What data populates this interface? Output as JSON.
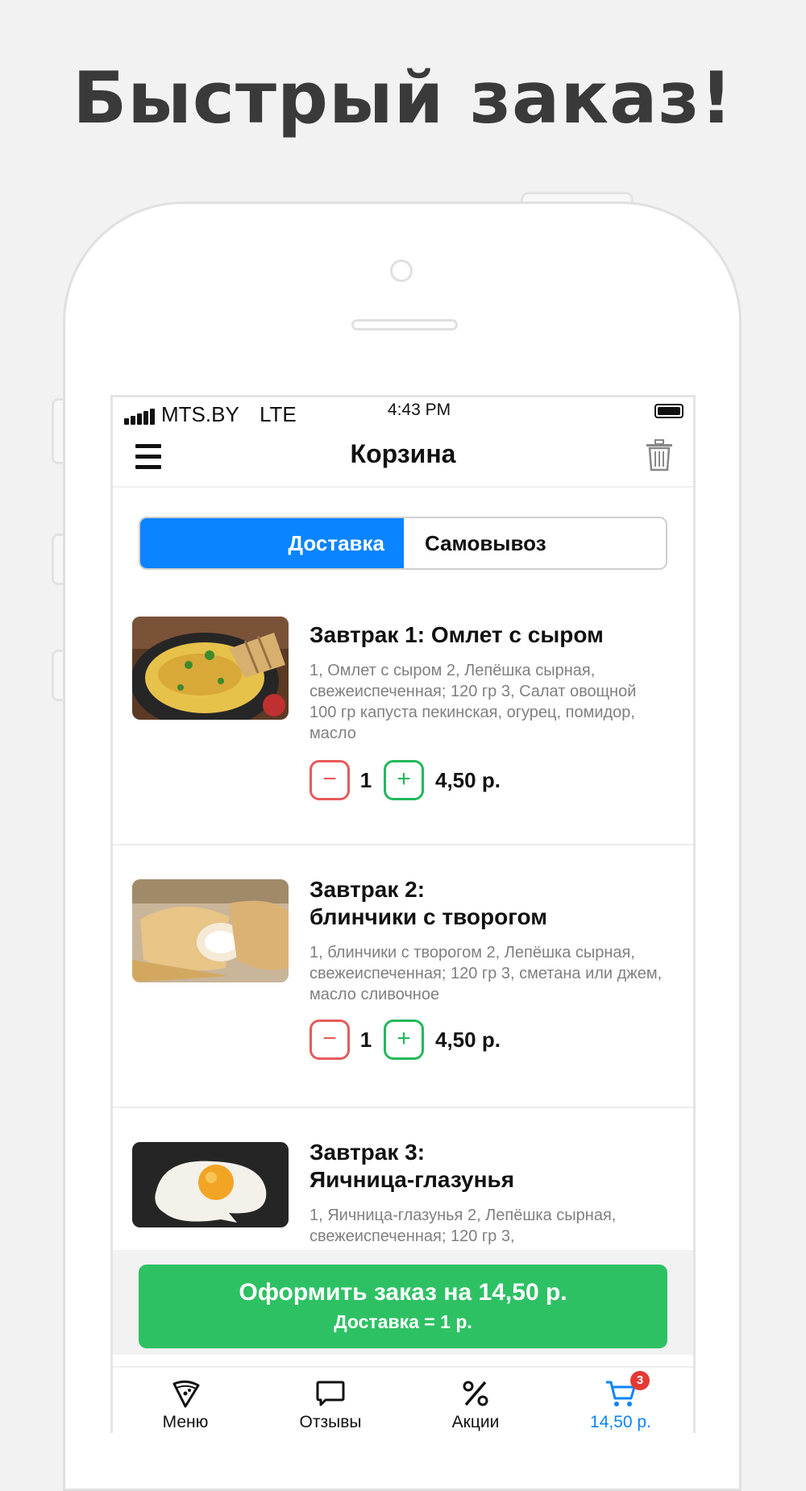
{
  "headline": "Быстрый заказ!",
  "status_bar": {
    "carrier": "MTS.BY",
    "network": "LTE",
    "time": "4:43 PM"
  },
  "navbar": {
    "title": "Корзина"
  },
  "delivery_toggle": {
    "active": "Доставка",
    "inactive": "Самовывоз"
  },
  "cart_items": [
    {
      "title": "Завтрак 1: Омлет с сыром",
      "description": "1, Омлет с сыром 2, Лепёшка сырная, свежеиспеченная; 120 гр 3, Салат овощной 100 гр капуста пекинская, огурец, помидор, масло",
      "minus": "−",
      "quantity": "1",
      "plus": "+",
      "price": "4,50 р."
    },
    {
      "title": "Завтрак 2:",
      "title_line2": "блинчики с творогом",
      "description": "1, блинчики с творогом 2, Лепёшка сырная, свежеиспеченная; 120 гр 3, сметана или джем, масло сливочное",
      "minus": "−",
      "quantity": "1",
      "plus": "+",
      "price": "4,50 р."
    },
    {
      "title": "Завтрак 3:",
      "title_line2": "Яичница-глазунья",
      "description": "1, Яичница-глазунья 2, Лепёшка сырная, свежеиспеченная; 120 гр 3,"
    }
  ],
  "checkout": {
    "main": "Оформить заказ на 14,50 р.",
    "sub": "Доставка = 1 р."
  },
  "tabbar": {
    "menu": "Меню",
    "reviews": "Отзывы",
    "promos": "Акции",
    "cart": "14,50 р.",
    "cart_badge": "3"
  },
  "colors": {
    "accent_blue": "#0a84ff",
    "checkout_green": "#2ec164",
    "minus_red": "#e85a5a",
    "plus_green": "#22b85a",
    "badge_red": "#e53935"
  }
}
